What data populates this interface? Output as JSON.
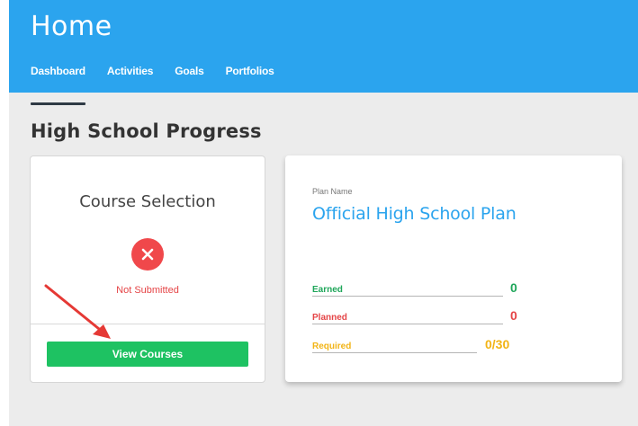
{
  "header": {
    "title": "Home",
    "tabs": [
      {
        "label": "Dashboard",
        "active": true
      },
      {
        "label": "Activities",
        "active": false
      },
      {
        "label": "Goals",
        "active": false
      },
      {
        "label": "Portfolios",
        "active": false
      }
    ]
  },
  "section": {
    "title": "High School Progress"
  },
  "course_card": {
    "title": "Course Selection",
    "status_icon": "x-circle-icon",
    "status_text": "Not Submitted",
    "button_label": "View Courses"
  },
  "plan_card": {
    "plan_label": "Plan Name",
    "plan_name": "Official High School Plan",
    "stats": [
      {
        "label": "Earned",
        "value": "0",
        "color": "#1fa65a"
      },
      {
        "label": "Planned",
        "value": "0",
        "color": "#e54547"
      },
      {
        "label": "Required",
        "value": "0/30",
        "color": "#f2b416"
      }
    ]
  },
  "colors": {
    "header_bg": "#2ba4ee",
    "accent_green": "#1ec262",
    "status_red": "#f0484b",
    "annotation_arrow": "#e53935"
  }
}
